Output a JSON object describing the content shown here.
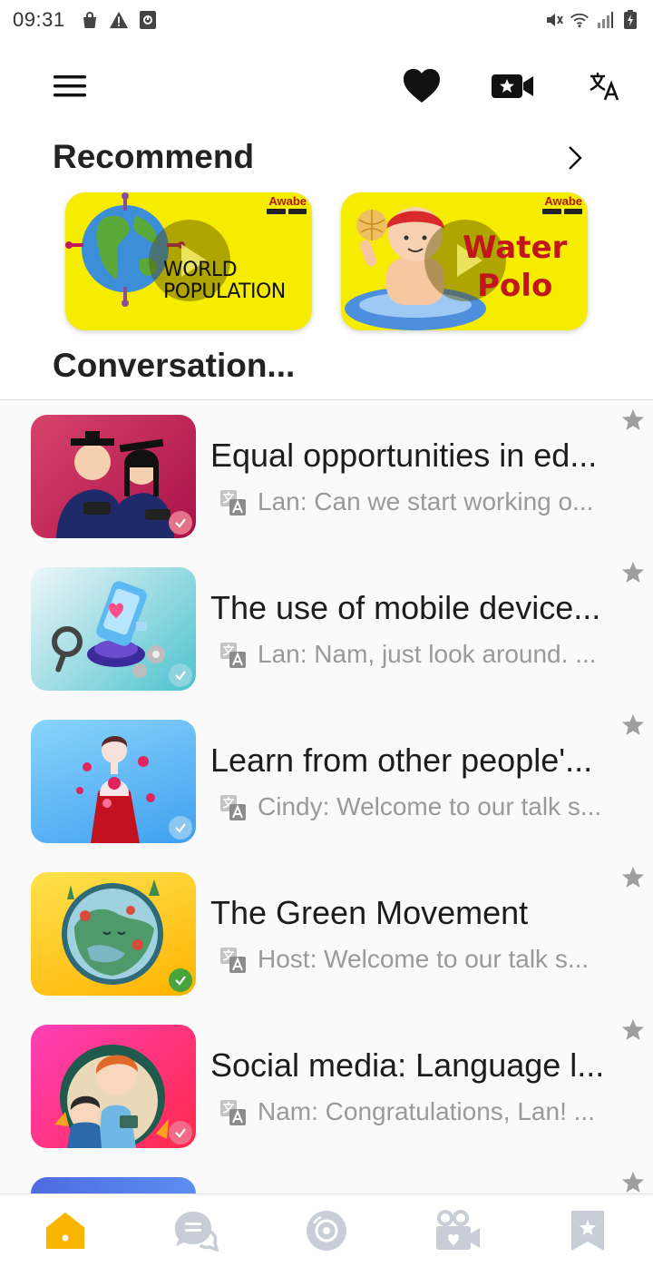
{
  "status_bar": {
    "time": "09:31",
    "left_icons": [
      "shopping-bag-icon",
      "warning-icon",
      "screenshot-icon"
    ],
    "right_icons": [
      "mute-icon",
      "wifi-icon",
      "signal-icon",
      "battery-charging-icon"
    ]
  },
  "top_bar": {
    "icons": [
      "menu-icon",
      "heart-icon",
      "video-star-icon",
      "translate-icon"
    ]
  },
  "recommend": {
    "title": "Recommend",
    "arrow_icon": "chevron-right-icon",
    "cards": [
      {
        "badge": "Awabe",
        "caption": "WORLD POPULATION",
        "line1": "WORLD",
        "line2": "POPULATION"
      },
      {
        "badge": "Awabe",
        "caption": "Water Polo",
        "line1": "Water",
        "line2": "Polo"
      }
    ]
  },
  "conversation": {
    "title": "Conversation...",
    "items": [
      {
        "title": "Equal opportunities in ed...",
        "subtitle": "Lan: Can we start working o...",
        "check_color": "#e5728a"
      },
      {
        "title": "The use of mobile device...",
        "subtitle": "Lan: Nam, just look around. ...",
        "check_color": "#8fd3de"
      },
      {
        "title": "Learn from other people'...",
        "subtitle": "Cindy: Welcome to our talk s...",
        "check_color": "#8cc7f2"
      },
      {
        "title": "The Green Movement",
        "subtitle": "Host:  Welcome to our talk s...",
        "check_color": "#49a43a"
      },
      {
        "title": "Social media: Language l...",
        "subtitle": "Nam: Congratulations, Lan! ...",
        "check_color": "#f06a8a"
      }
    ]
  },
  "bottom_nav": {
    "items": [
      "home-icon",
      "chat-icon",
      "disc-icon",
      "video-people-icon",
      "bookmark-star-icon"
    ],
    "active_color": "#f7b500",
    "inactive_color": "#c8cdd8"
  }
}
